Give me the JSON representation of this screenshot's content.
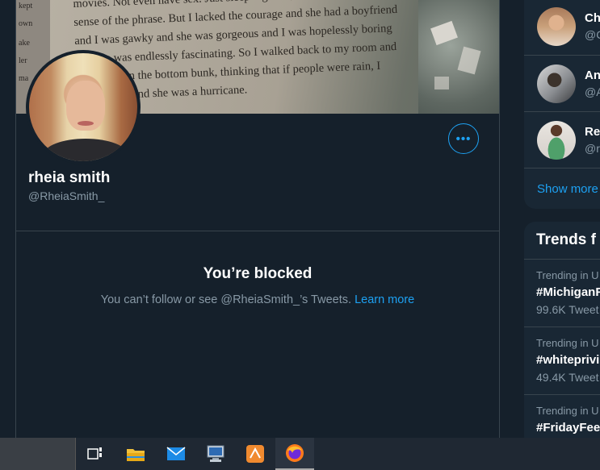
{
  "banner": {
    "margin_words": [
      "kept",
      "own",
      "ake",
      "ler",
      "ma"
    ],
    "lines": [
      "movies. Not even have sex. Just sleep together, in each oth",
      "sense of the phrase. But I lacked the courage and she had a boyfriend",
      "and I was gawky and she was gorgeous and I was hopelessly boring",
      "and she was endlessly fascinating. So I walked back to my room and",
      "collapsed on the bottom bunk, thinking that if people were rain, I",
      "was drizzle and she was a hurricane."
    ]
  },
  "profile": {
    "display_name": "rheia smith",
    "handle": "@RheiaSmith_",
    "more_icon": "•••"
  },
  "blocked": {
    "title": "You’re blocked",
    "message": "You can’t follow or see @RheiaSmith_’s Tweets.",
    "link": "Learn more"
  },
  "who_to_follow": {
    "users": [
      {
        "name": "Cha",
        "handle": "@C"
      },
      {
        "name": "An",
        "handle": "@A"
      },
      {
        "name": "Re",
        "handle": "@r"
      }
    ],
    "show_more": "Show more"
  },
  "trends": {
    "title": "Trends f",
    "items": [
      {
        "context": "Trending in U",
        "tag": "#MichiganF",
        "count": "99.6K Tweet"
      },
      {
        "context": "Trending in U",
        "tag": "#whiteprivi",
        "count": "49.4K Tweet"
      },
      {
        "context": "Trending in U",
        "tag": "#FridayFee",
        "count": ""
      }
    ]
  },
  "taskbar": {
    "icons": [
      "task-view-icon",
      "file-explorer-icon",
      "mail-icon",
      "remote-desktop-icon",
      "app-icon",
      "firefox-icon"
    ]
  },
  "colors": {
    "background": "#15202b",
    "panel": "#192734",
    "accent": "#1da1f2",
    "muted": "#8899a6",
    "border": "#38444d"
  }
}
